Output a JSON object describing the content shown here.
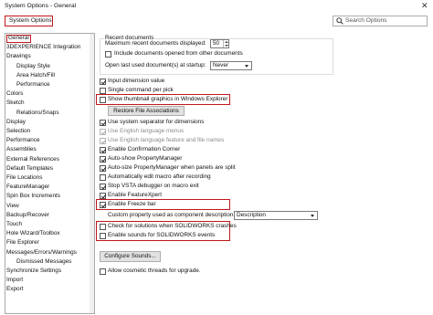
{
  "window": {
    "title": "System Options - General",
    "close_glyph": "✕"
  },
  "tab": {
    "label": "System Options"
  },
  "search": {
    "placeholder": "Search Options",
    "icon": "search-icon"
  },
  "tree": {
    "items": [
      {
        "label": "General",
        "indent": 0,
        "selected": true
      },
      {
        "label": "3DEXPERIENCE Integration",
        "indent": 0
      },
      {
        "label": "Drawings",
        "indent": 0
      },
      {
        "label": "Display Style",
        "indent": 1
      },
      {
        "label": "Area Hatch/Fill",
        "indent": 1
      },
      {
        "label": "Performance",
        "indent": 1
      },
      {
        "label": "Colors",
        "indent": 0
      },
      {
        "label": "Sketch",
        "indent": 0
      },
      {
        "label": "Relations/Snaps",
        "indent": 1
      },
      {
        "label": "Display",
        "indent": 0
      },
      {
        "label": "Selection",
        "indent": 0
      },
      {
        "label": "Performance",
        "indent": 0
      },
      {
        "label": "Assemblies",
        "indent": 0
      },
      {
        "label": "External References",
        "indent": 0
      },
      {
        "label": "Default Templates",
        "indent": 0
      },
      {
        "label": "File Locations",
        "indent": 0
      },
      {
        "label": "FeatureManager",
        "indent": 0
      },
      {
        "label": "Spin Box Increments",
        "indent": 0
      },
      {
        "label": "View",
        "indent": 0
      },
      {
        "label": "Backup/Recover",
        "indent": 0
      },
      {
        "label": "Touch",
        "indent": 0
      },
      {
        "label": "Hole Wizard/Toolbox",
        "indent": 0
      },
      {
        "label": "File Explorer",
        "indent": 0
      },
      {
        "label": "Messages/Errors/Warnings",
        "indent": 0
      },
      {
        "label": "Dismissed Messages",
        "indent": 1
      },
      {
        "label": "Synchronize Settings",
        "indent": 0
      },
      {
        "label": "Import",
        "indent": 0
      },
      {
        "label": "Export",
        "indent": 0
      }
    ]
  },
  "recent": {
    "group_label": "Recent documents",
    "max_label": "Maximum recent documents displayed:",
    "max_value": "50",
    "include_label": "Include documents opened from other documents",
    "include_checked": false,
    "open_last_label": "Open last used document(s) at startup:",
    "open_last_value": "Never"
  },
  "options": {
    "input_dimension_value": {
      "label": "Input dimension value",
      "checked": true
    },
    "single_command": {
      "label": "Single command per pick",
      "checked": false
    },
    "show_thumbnail": {
      "label": "Show thumbnail graphics in Windows Explorer",
      "checked": false
    },
    "restore_file_assoc": {
      "label": "Restore File Associations"
    },
    "use_system_separator": {
      "label": "Use system separator for dimensions",
      "checked": true
    },
    "use_english_menus": {
      "label": "Use English language menus",
      "checked": true,
      "disabled": true
    },
    "use_english_feature": {
      "label": "Use English language feature and file names",
      "checked": true,
      "disabled": true
    },
    "enable_confirmation": {
      "label": "Enable Confirmation Corner",
      "checked": true
    },
    "auto_show_pm": {
      "label": "Auto-show PropertyManager",
      "checked": true
    },
    "auto_size_pm": {
      "label": "Auto-size PropertyManager when panels are split",
      "checked": true
    },
    "auto_edit_macro": {
      "label": "Automatically edit macro after recording",
      "checked": false
    },
    "stop_vsta": {
      "label": "Stop VSTA debugger on macro exit",
      "checked": true
    },
    "enable_featurexpert": {
      "label": "Enable FeatureXpert",
      "checked": true
    },
    "enable_freeze_bar": {
      "label": "Enable Freeze bar",
      "checked": true
    },
    "custom_property_label": "Custom property used as component description:",
    "custom_property_value": "Description",
    "check_solutions": {
      "label": "Check for solutions when SOLIDWORKS crashes",
      "checked": false
    },
    "enable_sounds": {
      "label": "Enable sounds for SOLIDWORKS events",
      "checked": false
    },
    "configure_sounds": {
      "label": "Configure Sounds..."
    },
    "allow_cosmetic": {
      "label": "Allow cosmetic threads for upgrade.",
      "checked": false
    }
  },
  "colors": {
    "highlight": "#c0171b",
    "border": "#a9a9a9",
    "button_bg": "#e1e1e1"
  }
}
